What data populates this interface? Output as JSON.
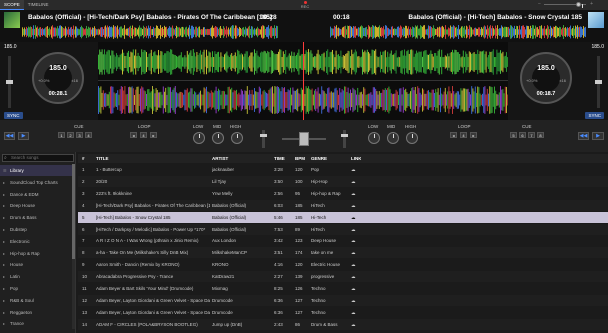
{
  "tabs": [
    "SCOPE",
    "TIMELINE"
  ],
  "rec_label": "REC",
  "deck_left": {
    "title": "Babalos (Official) - [Hi-Tech/Dark Psy] Babalos - Pirates Of The Caribbean [185]",
    "time": "00:28",
    "bpm": "185.0",
    "pitch": "+0.0%",
    "range": "±16",
    "elapsed": "00:28.1",
    "side_bpm": "185.0",
    "sync": "SYNC"
  },
  "deck_right": {
    "title": "Babalos (Official) - [Hi-Tech] Babalos - Snow Crystal 185",
    "time": "00:18",
    "bpm": "185.0",
    "pitch": "+0.0%",
    "range": "±16",
    "elapsed": "00:18.7",
    "side_bpm": "185.0",
    "sync": "SYNC"
  },
  "controls": {
    "cue": "CUE",
    "loop": "LOOP",
    "low": "LOW",
    "mid": "MID",
    "high": "HIGH",
    "left_cues": [
      "1",
      "2",
      "3",
      "4"
    ],
    "left_loop": "4",
    "right_loop": "4",
    "right_cues": [
      "5",
      "6",
      "7",
      "8"
    ]
  },
  "search": {
    "placeholder": "Search songs"
  },
  "sidebar": [
    {
      "label": "Library"
    },
    {
      "label": "SoundCloud Top Charts"
    },
    {
      "label": "Dance & EDM"
    },
    {
      "label": "Deep House"
    },
    {
      "label": "Drum & Bass"
    },
    {
      "label": "Dubstep"
    },
    {
      "label": "Electronic"
    },
    {
      "label": "Hip-hop & Rap"
    },
    {
      "label": "House"
    },
    {
      "label": "Latin"
    },
    {
      "label": "Pop"
    },
    {
      "label": "R&B & Soul"
    },
    {
      "label": "Reggaeton"
    },
    {
      "label": "Trance"
    }
  ],
  "columns": {
    "num": "#",
    "title": "TITLE",
    "artist": "ARTIST",
    "time": "TIME",
    "bpm": "BPM",
    "genre": "GENRE",
    "link": "LINK"
  },
  "rows": [
    {
      "num": "1",
      "title": "1 - Buttercup",
      "artist": "jacknauber",
      "time": "3:28",
      "bpm": "120",
      "genre": "Pop",
      "link": "☁"
    },
    {
      "num": "2",
      "title": "20/20",
      "artist": "Lil Tjay",
      "time": "3:50",
      "bpm": "100",
      "genre": "Hip-Hop",
      "link": "☁"
    },
    {
      "num": "3",
      "title": "223's ft. 9lokknine",
      "artist": "Ynw Melly",
      "time": "2:56",
      "bpm": "95",
      "genre": "Hip-hop & Rap",
      "link": "☁"
    },
    {
      "num": "4",
      "title": "[Hi-Tech/Dark Psy] Babalos - Pirates Of The Caribbean [185]",
      "artist": "Babalos (Official)",
      "time": "6:03",
      "bpm": "185",
      "genre": "HiTech",
      "link": "☁"
    },
    {
      "num": "5",
      "title": "[Hi-Tech] Babalos - Snow Crystal 185",
      "artist": "Babalos (Official)",
      "time": "5:46",
      "bpm": "185",
      "genre": "Hi-Tech",
      "link": "☁"
    },
    {
      "num": "6",
      "title": "[HiTech / Darkpsy / Melodic] Babalos - Power Up *170*",
      "artist": "Babalos (Official)",
      "time": "7:53",
      "bpm": "89",
      "genre": "HiTech",
      "link": "☁"
    },
    {
      "num": "7",
      "title": "A R I Z O N A - I Was Wrong (pthrain x Jinio Remix)",
      "artist": "Aux London",
      "time": "3:42",
      "bpm": "123",
      "genre": "Deep House",
      "link": "☁"
    },
    {
      "num": "8",
      "title": "a-ha - Take On Me (Milkshake's Silly DnB Mix)",
      "artist": "MilkshakeManCP",
      "time": "3:51",
      "bpm": "174",
      "genre": "take on me",
      "link": "☁"
    },
    {
      "num": "9",
      "title": "Aaron Smith - Dancin (Remix by KRONO)",
      "artist": "KRONO",
      "time": "4:16",
      "bpm": "120",
      "genre": "Electric House",
      "link": "☁"
    },
    {
      "num": "10",
      "title": "Abracadabra Progressive Psy - Trance",
      "artist": "KatDraw21",
      "time": "2:27",
      "bpm": "139",
      "genre": "progressive",
      "link": "☁"
    },
    {
      "num": "11",
      "title": "Adam Beyer & Bart Skils 'Your Mind' (Drumcode)",
      "artist": "Mixmag",
      "time": "8:25",
      "bpm": "126",
      "genre": "Techno",
      "link": "☁"
    },
    {
      "num": "12",
      "title": "Adam Beyer, Layton Giordani & Green Velvet - Space Date",
      "artist": "Drumcode",
      "time": "6:36",
      "bpm": "127",
      "genre": "Techno",
      "link": "☁"
    },
    {
      "num": "13",
      "title": "Adam Beyer, Layton Giordani & Green Velvet - Space Date",
      "artist": "Drumcode",
      "time": "6:36",
      "bpm": "127",
      "genre": "Techno",
      "link": "☁"
    },
    {
      "num": "14",
      "title": "ADAM F - CIRCLES (POLA&BRYSON BOOTLEG)",
      "artist": "Jump up (DnB)",
      "time": "2:43",
      "bpm": "86",
      "genre": "Drum & Bass",
      "link": "☁"
    }
  ],
  "colors": {
    "accent": "#4a8cff",
    "selected_row": "#c9c3d8",
    "selected_sidebar": "#34324a",
    "playhead": "#ff3b3b"
  }
}
